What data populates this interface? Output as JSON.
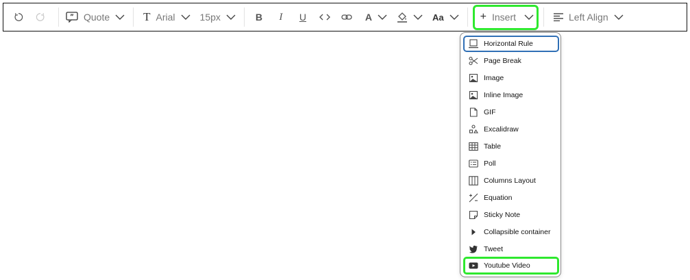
{
  "toolbar": {
    "block_type": "Quote",
    "font_family": "Arial",
    "font_size": "15px",
    "bold_glyph": "B",
    "italic_glyph": "I",
    "underline_glyph": "U",
    "font_color_glyph": "A",
    "case_glyph": "Aa",
    "text_glyph": "T",
    "insert_label": "Insert",
    "insert_prefix": "+",
    "align_label": "Left Align"
  },
  "insert_menu": {
    "items": [
      {
        "label": "Horizontal Rule",
        "icon": "horizontal-rule-icon"
      },
      {
        "label": "Page Break",
        "icon": "scissors-icon"
      },
      {
        "label": "Image",
        "icon": "image-icon"
      },
      {
        "label": "Inline Image",
        "icon": "inline-image-icon"
      },
      {
        "label": "GIF",
        "icon": "gif-file-icon"
      },
      {
        "label": "Excalidraw",
        "icon": "excalidraw-icon"
      },
      {
        "label": "Table",
        "icon": "table-icon"
      },
      {
        "label": "Poll",
        "icon": "poll-icon"
      },
      {
        "label": "Columns Layout",
        "icon": "columns-icon"
      },
      {
        "label": "Equation",
        "icon": "equation-icon"
      },
      {
        "label": "Sticky Note",
        "icon": "sticky-note-icon"
      },
      {
        "label": "Collapsible container",
        "icon": "caret-right-icon"
      },
      {
        "label": "Tweet",
        "icon": "twitter-icon"
      },
      {
        "label": "Youtube Video",
        "icon": "youtube-icon"
      }
    ]
  },
  "colors": {
    "highlight_green": "#2ee82e",
    "focus_blue": "#2f6fb5"
  }
}
